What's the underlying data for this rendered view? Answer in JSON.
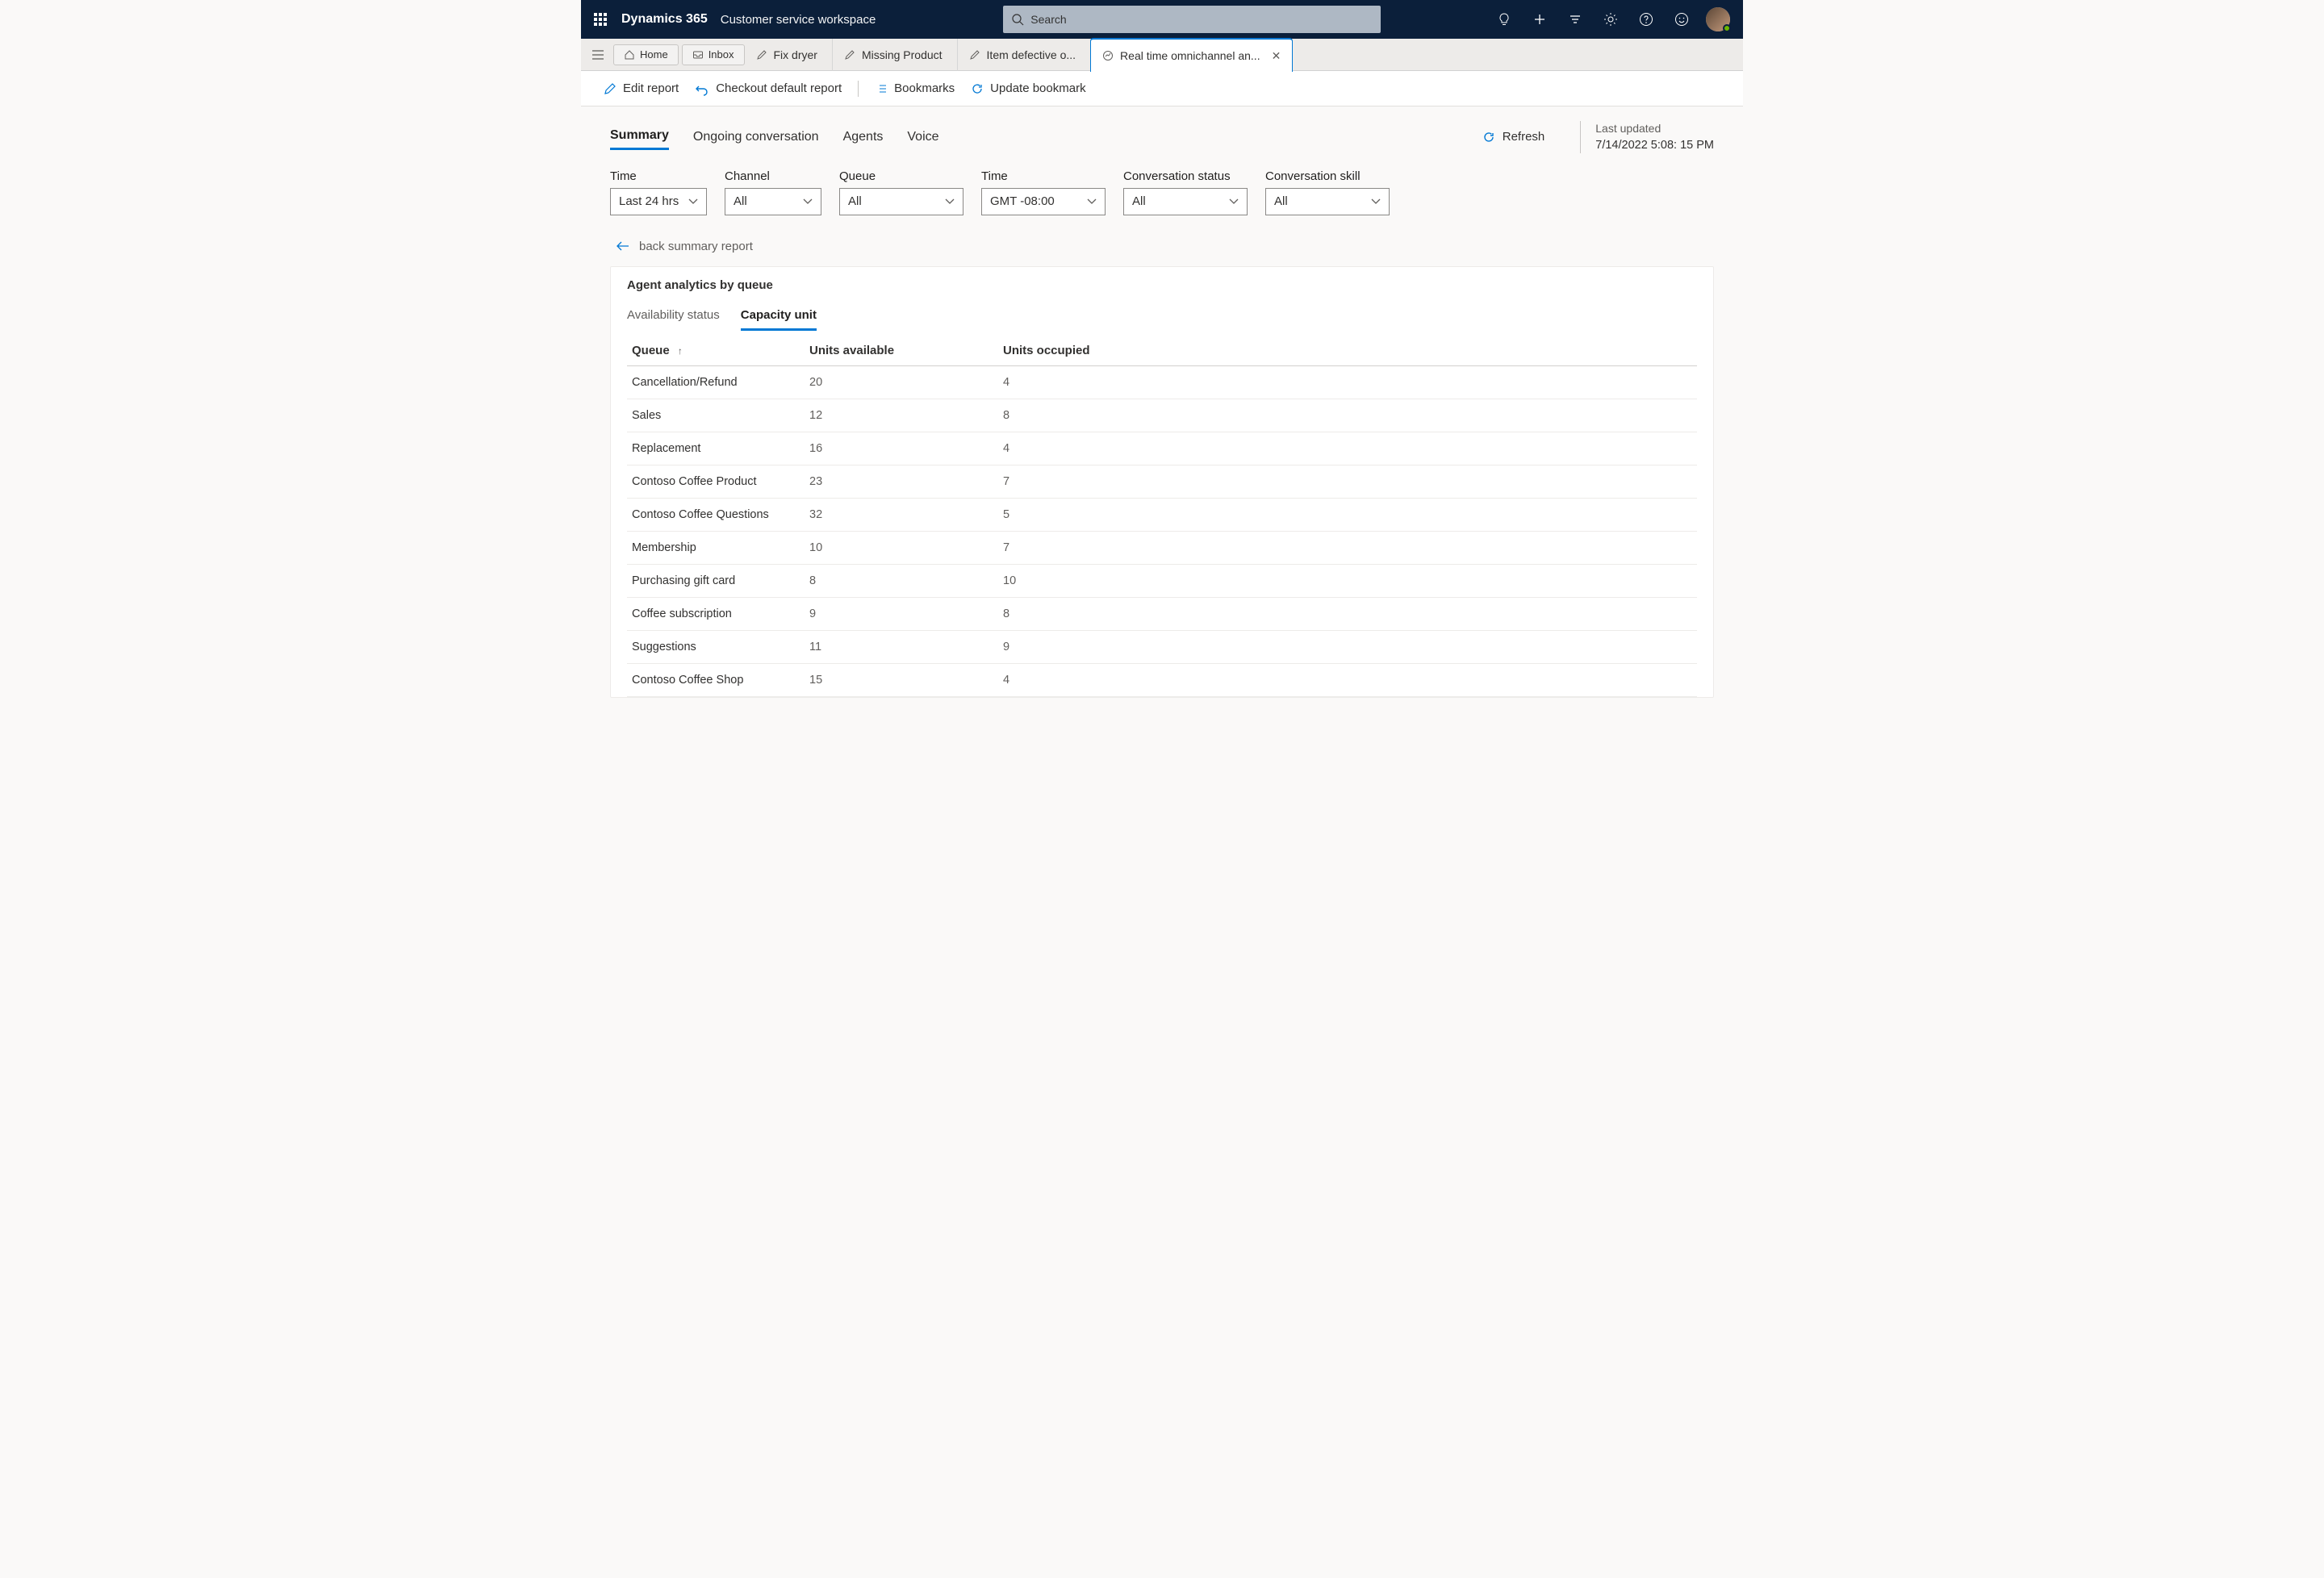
{
  "header": {
    "brand": "Dynamics 365",
    "subbrand": "Customer service workspace",
    "searchPlaceholder": "Search"
  },
  "tabs": {
    "home": "Home",
    "inbox": "Inbox",
    "items": [
      {
        "label": "Fix dryer"
      },
      {
        "label": "Missing Product"
      },
      {
        "label": "Item defective o..."
      },
      {
        "label": "Real time omnichannel an..."
      }
    ]
  },
  "toolbar": {
    "edit": "Edit report",
    "checkout": "Checkout default report",
    "bookmarks": "Bookmarks",
    "update": "Update bookmark"
  },
  "subtabs": {
    "summary": "Summary",
    "ongoing": "Ongoing conversation",
    "agents": "Agents",
    "voice": "Voice"
  },
  "refresh": {
    "label": "Refresh"
  },
  "lastUpdated": {
    "label": "Last updated",
    "value": "7/14/2022 5:08: 15 PM"
  },
  "filters": [
    {
      "label": "Time",
      "value": "Last 24 hrs",
      "w": 120
    },
    {
      "label": "Channel",
      "value": "All",
      "w": 120
    },
    {
      "label": "Queue",
      "value": "All",
      "w": 154
    },
    {
      "label": "Time",
      "value": "GMT -08:00",
      "w": 154
    },
    {
      "label": "Conversation status",
      "value": "All",
      "w": 154
    },
    {
      "label": "Conversation skill",
      "value": "All",
      "w": 154
    }
  ],
  "back": "back summary report",
  "card": {
    "title": "Agent analytics by queue",
    "tabs": {
      "availability": "Availability status",
      "capacity": "Capacity unit"
    },
    "columns": {
      "queue": "Queue",
      "available": "Units available",
      "occupied": "Units occupied"
    },
    "rows": [
      {
        "queue": "Cancellation/Refund",
        "available": "20",
        "occupied": "4"
      },
      {
        "queue": "Sales",
        "available": "12",
        "occupied": "8"
      },
      {
        "queue": "Replacement",
        "available": "16",
        "occupied": "4"
      },
      {
        "queue": "Contoso Coffee Product",
        "available": "23",
        "occupied": "7"
      },
      {
        "queue": "Contoso Coffee Questions",
        "available": "32",
        "occupied": "5"
      },
      {
        "queue": "Membership",
        "available": "10",
        "occupied": "7"
      },
      {
        "queue": "Purchasing gift card",
        "available": "8",
        "occupied": "10"
      },
      {
        "queue": "Coffee subscription",
        "available": "9",
        "occupied": "8"
      },
      {
        "queue": "Suggestions",
        "available": "11",
        "occupied": "9"
      },
      {
        "queue": "Contoso Coffee Shop",
        "available": "15",
        "occupied": "4"
      }
    ]
  }
}
